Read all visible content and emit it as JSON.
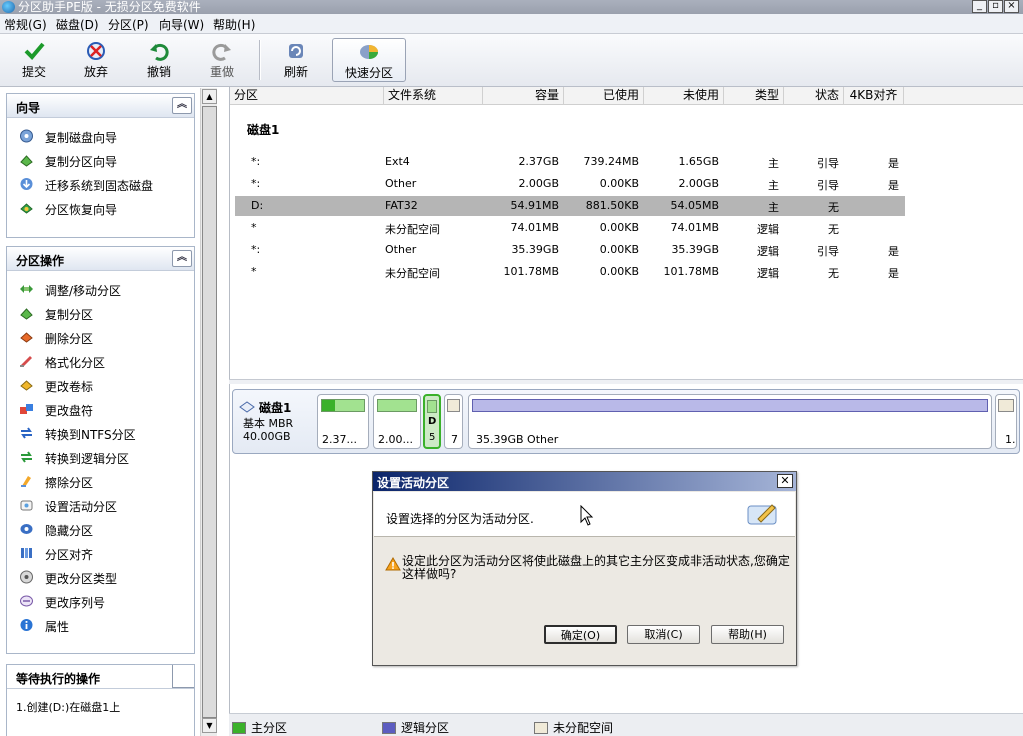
{
  "window": {
    "title": "分区助手PE版 - 无损分区免费软件"
  },
  "menu": [
    "常规(G)",
    "磁盘(D)",
    "分区(P)",
    "向导(W)",
    "帮助(H)"
  ],
  "toolbar": [
    {
      "label": "提交",
      "icon": "check-icon"
    },
    {
      "label": "放弃",
      "icon": "discard-icon"
    },
    {
      "label": "撤销",
      "icon": "undo-icon"
    },
    {
      "label": "重做",
      "icon": "redo-icon"
    },
    {
      "label": "刷新",
      "icon": "refresh-icon"
    },
    {
      "label": "快速分区",
      "icon": "quick-partition-icon"
    }
  ],
  "wizard_panel": {
    "title": "向导",
    "items": [
      "复制磁盘向导",
      "复制分区向导",
      "迁移系统到固态磁盘",
      "分区恢复向导"
    ]
  },
  "ops_panel": {
    "title": "分区操作",
    "items": [
      "调整/移动分区",
      "复制分区",
      "删除分区",
      "格式化分区",
      "更改卷标",
      "更改盘符",
      "转换到NTFS分区",
      "转换到逻辑分区",
      "擦除分区",
      "设置活动分区",
      "隐藏分区",
      "分区对齐",
      "更改分区类型",
      "更改序列号",
      "属性"
    ]
  },
  "pending_panel": {
    "title": "等待执行的操作",
    "items": [
      "1.创建(D:)在磁盘1上"
    ]
  },
  "partition_list": {
    "columns": [
      "分区",
      "文件系统",
      "容量",
      "已使用",
      "未使用",
      "类型",
      "状态",
      "4KB对齐"
    ],
    "disk_label": "磁盘1",
    "rows": [
      {
        "part": "*:",
        "fs": "Ext4",
        "cap": "2.37GB",
        "used": "739.24MB",
        "free": "1.65GB",
        "type": "主",
        "status": "引导",
        "align": "是"
      },
      {
        "part": "*:",
        "fs": "Other",
        "cap": "2.00GB",
        "used": "0.00KB",
        "free": "2.00GB",
        "type": "主",
        "status": "引导",
        "align": "是"
      },
      {
        "part": "D:",
        "fs": "FAT32",
        "cap": "54.91MB",
        "used": "881.50KB",
        "free": "54.05MB",
        "type": "主",
        "status": "无",
        "align": ""
      },
      {
        "part": "*",
        "fs": "未分配空间",
        "cap": "74.01MB",
        "used": "0.00KB",
        "free": "74.01MB",
        "type": "逻辑",
        "status": "无",
        "align": ""
      },
      {
        "part": "*:",
        "fs": "Other",
        "cap": "35.39GB",
        "used": "0.00KB",
        "free": "35.39GB",
        "type": "逻辑",
        "status": "引导",
        "align": "是"
      },
      {
        "part": "*",
        "fs": "未分配空间",
        "cap": "101.78MB",
        "used": "0.00KB",
        "free": "101.78MB",
        "type": "逻辑",
        "status": "无",
        "align": "是"
      }
    ]
  },
  "disk_map": {
    "name": "磁盘1",
    "kind": "基本 MBR",
    "size": "40.00GB",
    "blocks": [
      {
        "label": "2.37...",
        "used_fraction": 0.3
      },
      {
        "label": "2.00...",
        "used_fraction": 0
      },
      {
        "label_top": "D",
        "label_bottom": "5"
      },
      {
        "label": "7"
      },
      {
        "label": "35.39GB Other"
      },
      {
        "label": "1."
      }
    ]
  },
  "dialog": {
    "title": "设置活动分区",
    "intro": "设置选择的分区为活动分区.",
    "warning": "设定此分区为活动分区将使此磁盘上的其它主分区变成非活动状态,您确定这样做吗?",
    "buttons": {
      "ok": "确定(O)",
      "cancel": "取消(C)",
      "help": "帮助(H)"
    }
  },
  "legend": [
    "主分区",
    "逻辑分区",
    "未分配空间"
  ],
  "colors": {
    "primary": "#3ab12a",
    "logical": "#5c5cc0",
    "unallocated": "#f0ead8",
    "selected_row": "#b5b5b5"
  }
}
